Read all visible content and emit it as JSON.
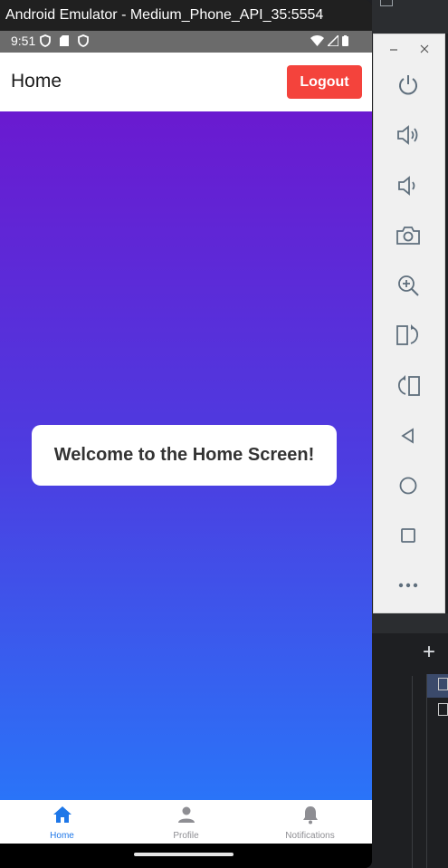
{
  "window": {
    "title": "Android Emulator - Medium_Phone_API_35:5554"
  },
  "status_bar": {
    "time": "9:51",
    "icons_left": [
      "shield-icon",
      "sd-card-icon",
      "shield-icon"
    ],
    "icons_right": [
      "wifi-icon",
      "signal-icon",
      "battery-icon"
    ]
  },
  "app_bar": {
    "title": "Home",
    "logout_label": "Logout",
    "logout_color": "#f4433c"
  },
  "content": {
    "welcome_text": "Welcome to the Home Screen!",
    "gradient_top": "#6a1ad0",
    "gradient_bottom": "#2a74f8"
  },
  "bottom_nav": {
    "active_color": "#1e77e8",
    "tabs": [
      {
        "label": "Home",
        "icon": "home-icon",
        "active": true
      },
      {
        "label": "Profile",
        "icon": "person-icon",
        "active": false
      },
      {
        "label": "Notifications",
        "icon": "bell-icon",
        "active": false
      }
    ]
  },
  "emulator_toolbar": {
    "buttons": [
      "power-icon",
      "volume-up-icon",
      "volume-down-icon",
      "camera-icon",
      "zoom-icon",
      "rotate-left-icon",
      "rotate-right-icon",
      "back-icon",
      "home-circle-icon",
      "overview-icon",
      "more-icon"
    ]
  }
}
